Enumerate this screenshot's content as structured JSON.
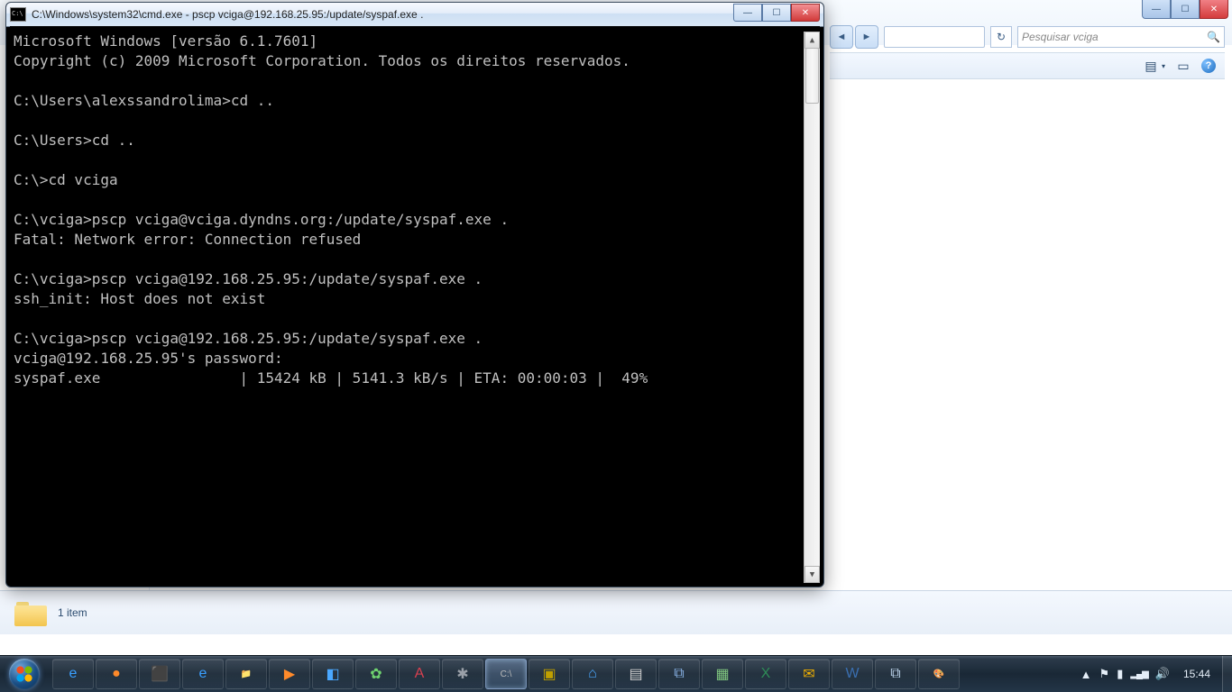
{
  "explorer_bg": {
    "win_min": "—",
    "win_max": "☐",
    "win_close": "✕",
    "nav_back": "◄",
    "nav_fwd": "►",
    "nav_refresh": "↻",
    "search_placeholder": "Pesquisar vciga",
    "search_icon": "🔍",
    "view_icon": "▤",
    "view_drop": "▾",
    "preview_icon": "▭",
    "help_icon": "?",
    "status_count": "1 item"
  },
  "cmd": {
    "title": "C:\\Windows\\system32\\cmd.exe - pscp  vciga@192.168.25.95:/update/syspaf.exe .",
    "min": "—",
    "max": "☐",
    "close": "✕",
    "sb_up": "▲",
    "sb_dn": "▼",
    "lines": "Microsoft Windows [versão 6.1.7601]\nCopyright (c) 2009 Microsoft Corporation. Todos os direitos reservados.\n\nC:\\Users\\alexssandrolima>cd ..\n\nC:\\Users>cd ..\n\nC:\\>cd vciga\n\nC:\\vciga>pscp vciga@vciga.dyndns.org:/update/syspaf.exe .\nFatal: Network error: Connection refused\n\nC:\\vciga>pscp vciga@192.168.25.95:/update/syspaf.exe .\nssh_init: Host does not exist\n\nC:\\vciga>pscp vciga@192.168.25.95:/update/syspaf.exe .\nvciga@192.168.25.95's password:\nsyspaf.exe                | 15424 kB | 5141.3 kB/s | ETA: 00:00:03 |  49%"
  },
  "taskbar": {
    "items": [
      {
        "g": "e",
        "c": "#3aa0ff"
      },
      {
        "g": "●",
        "c": "#ff8a2a"
      },
      {
        "g": "⬛",
        "c": "#8a5cff"
      },
      {
        "g": "e",
        "c": "#3aa0ff"
      },
      {
        "g": "📁",
        "c": "#f2c44e"
      },
      {
        "g": "▶",
        "c": "#ff8a2a"
      },
      {
        "g": "◧",
        "c": "#4aa8ff"
      },
      {
        "g": "✿",
        "c": "#6fd36f"
      },
      {
        "g": "A",
        "c": "#d84050"
      },
      {
        "g": "✱",
        "c": "#9aa0a8"
      },
      {
        "g": "C:\\",
        "c": "#bbb"
      },
      {
        "g": "▣",
        "c": "#c0a000"
      },
      {
        "g": "⌂",
        "c": "#4aa8ff"
      },
      {
        "g": "▤",
        "c": "#d0d0d0"
      },
      {
        "g": "⧉",
        "c": "#8ab4e8"
      },
      {
        "g": "▦",
        "c": "#7fc47f"
      },
      {
        "g": "X",
        "c": "#2e8b57"
      },
      {
        "g": "✉",
        "c": "#f0b000"
      },
      {
        "g": "W",
        "c": "#3a6fb0"
      },
      {
        "g": "⧉",
        "c": "#c0d8f0"
      },
      {
        "g": "🎨",
        "c": "#d88050"
      }
    ],
    "tray_expand": "▲",
    "tray_flag": "⚑",
    "tray_net": "▮",
    "tray_wifi": "▂▄▆",
    "tray_vol": "🔊",
    "clock": "15:44"
  }
}
